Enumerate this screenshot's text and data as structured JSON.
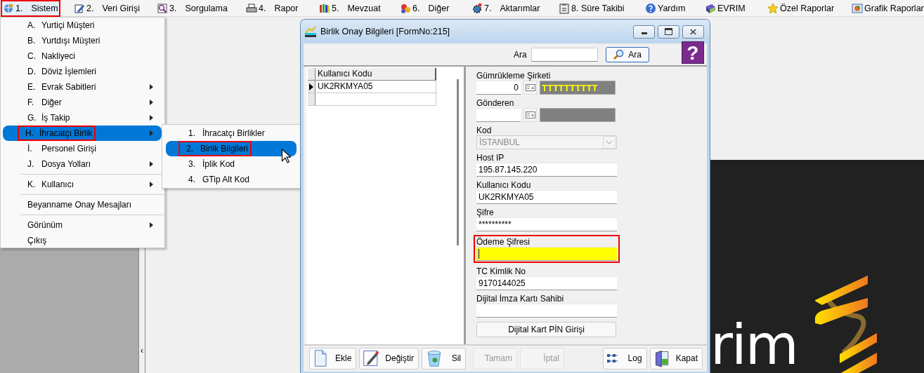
{
  "menubar": [
    {
      "key": "1.",
      "label": "Sistem",
      "selected": true,
      "annotated": true
    },
    {
      "key": "2.",
      "label": "Veri Girişi",
      "selected": false,
      "annotated": false
    },
    {
      "key": "3.",
      "label": "Sorgulama",
      "selected": false,
      "annotated": false
    },
    {
      "key": "4.",
      "label": "Rapor",
      "selected": false,
      "annotated": false
    },
    {
      "key": "5.",
      "label": "Mevzuat",
      "selected": false,
      "annotated": false
    },
    {
      "key": "6.",
      "label": "Diğer",
      "selected": false,
      "annotated": false
    },
    {
      "key": "7.",
      "label": "Aktarımlar",
      "selected": false,
      "annotated": false
    },
    {
      "label": "8. Süre Takibi",
      "selected": false,
      "annotated": false
    },
    {
      "label": "Yardım",
      "selected": false,
      "annotated": false
    },
    {
      "label": "EVRIM",
      "selected": false,
      "annotated": false
    },
    {
      "label": "Özel Raporlar",
      "selected": false,
      "annotated": false
    },
    {
      "label": "Grafik Raporlar",
      "selected": false,
      "annotated": false
    }
  ],
  "sistem_menu": {
    "groups": [
      [
        {
          "key": "A.",
          "label": "Yurtiçi Müşteri",
          "submenu": false,
          "selected": false,
          "annotated": false
        },
        {
          "key": "B.",
          "label": "Yurtdışı Müşteri",
          "submenu": false,
          "selected": false,
          "annotated": false
        },
        {
          "key": "C.",
          "label": "Nakliyeci",
          "submenu": false,
          "selected": false,
          "annotated": false
        },
        {
          "key": "D.",
          "label": "Döviz İşlemleri",
          "submenu": false,
          "selected": false,
          "annotated": false
        },
        {
          "key": "E.",
          "label": "Evrak Sabitleri",
          "submenu": true,
          "selected": false,
          "annotated": false
        },
        {
          "key": "F.",
          "label": "Diğer",
          "submenu": true,
          "selected": false,
          "annotated": false
        },
        {
          "key": "G.",
          "label": "İş Takip",
          "submenu": true,
          "selected": false,
          "annotated": false
        },
        {
          "key": "H.",
          "label": "İhracatçı Birlik",
          "submenu": true,
          "selected": true,
          "annotated": true
        },
        {
          "key": "İ.",
          "label": "Personel Girişi",
          "submenu": false,
          "selected": false,
          "annotated": false
        },
        {
          "key": "J.",
          "label": "Dosya Yolları",
          "submenu": true,
          "selected": false,
          "annotated": false
        }
      ],
      [
        {
          "key": "K.",
          "label": "Kullanıcı",
          "submenu": true,
          "selected": false,
          "annotated": false
        }
      ],
      [
        {
          "label": "Beyanname Onay Mesajları",
          "submenu": false,
          "selected": false,
          "annotated": false
        }
      ],
      [
        {
          "label": "Görünüm",
          "submenu": true,
          "selected": false,
          "annotated": false
        },
        {
          "label": "Çıkış",
          "submenu": false,
          "selected": false,
          "annotated": false
        }
      ]
    ]
  },
  "submenu": {
    "items": [
      {
        "key": "1.",
        "label": "İhracatçı Birlikler",
        "selected": false,
        "annotated": false
      },
      {
        "key": "2.",
        "label": "Birlik Bilgileri",
        "selected": true,
        "annotated": true
      },
      {
        "key": "3.",
        "label": "İplik Kod",
        "selected": false,
        "annotated": false
      },
      {
        "key": "4.",
        "label": "GTip Alt Kod",
        "selected": false,
        "annotated": false
      }
    ]
  },
  "sidebar_toggle": "‹",
  "logo_text": "rim",
  "dialog": {
    "title": "Birlik Onay Bilgileri [FormNo:215]",
    "search_label": "Ara",
    "search_button": "Ara",
    "help_glyph": "?",
    "grid": {
      "columns": [
        "Kullanıcı Kodu"
      ],
      "rows": [
        {
          "cells": [
            "UK2RKMYA05"
          ],
          "current": true
        },
        {
          "current": false
        }
      ]
    },
    "fields": [
      {
        "kind": "lookup",
        "label": "Gümrükleme Şirketi",
        "value": "0",
        "description": "TTTTTTTTTT",
        "focused": false,
        "annotated": false
      },
      {
        "kind": "lookup",
        "label": "Gönderen",
        "focused": false,
        "annotated": false
      },
      {
        "kind": "select",
        "label": "Kod",
        "value": "İSTANBUL",
        "disabled": true,
        "focused": false,
        "annotated": false
      },
      {
        "kind": "text",
        "label": "Host IP",
        "value": "195.87.145.220",
        "focused": false,
        "annotated": false
      },
      {
        "kind": "text",
        "label": "Kullanıcı Kodu",
        "value": "UK2RKMYA05",
        "focused": false,
        "annotated": false
      },
      {
        "kind": "text",
        "label": "Şifre",
        "value": "**********",
        "focused": false,
        "annotated": false
      },
      {
        "kind": "text",
        "label": "Ödeme Şifresi",
        "focused": true,
        "annotated": true
      },
      {
        "kind": "text",
        "label": "TC Kimlik No",
        "value": "9170144025",
        "focused": false,
        "annotated": false
      },
      {
        "kind": "text",
        "label": "Dijital İmza Kartı Sahibi",
        "focused": false,
        "annotated": false
      },
      {
        "kind": "button",
        "label": "Dijital Kart PİN Girişi"
      }
    ],
    "buttons_left": [
      {
        "label": "Ekle",
        "disabled": false
      },
      {
        "label": "Değiştir",
        "disabled": false
      },
      {
        "label": "Sil",
        "disabled": false
      },
      {
        "label": "Tamam",
        "disabled": true
      },
      {
        "label": "İptal",
        "disabled": true
      }
    ],
    "buttons_right": [
      {
        "label": "Log",
        "disabled": false
      },
      {
        "label": "Kapat",
        "disabled": false
      }
    ]
  }
}
